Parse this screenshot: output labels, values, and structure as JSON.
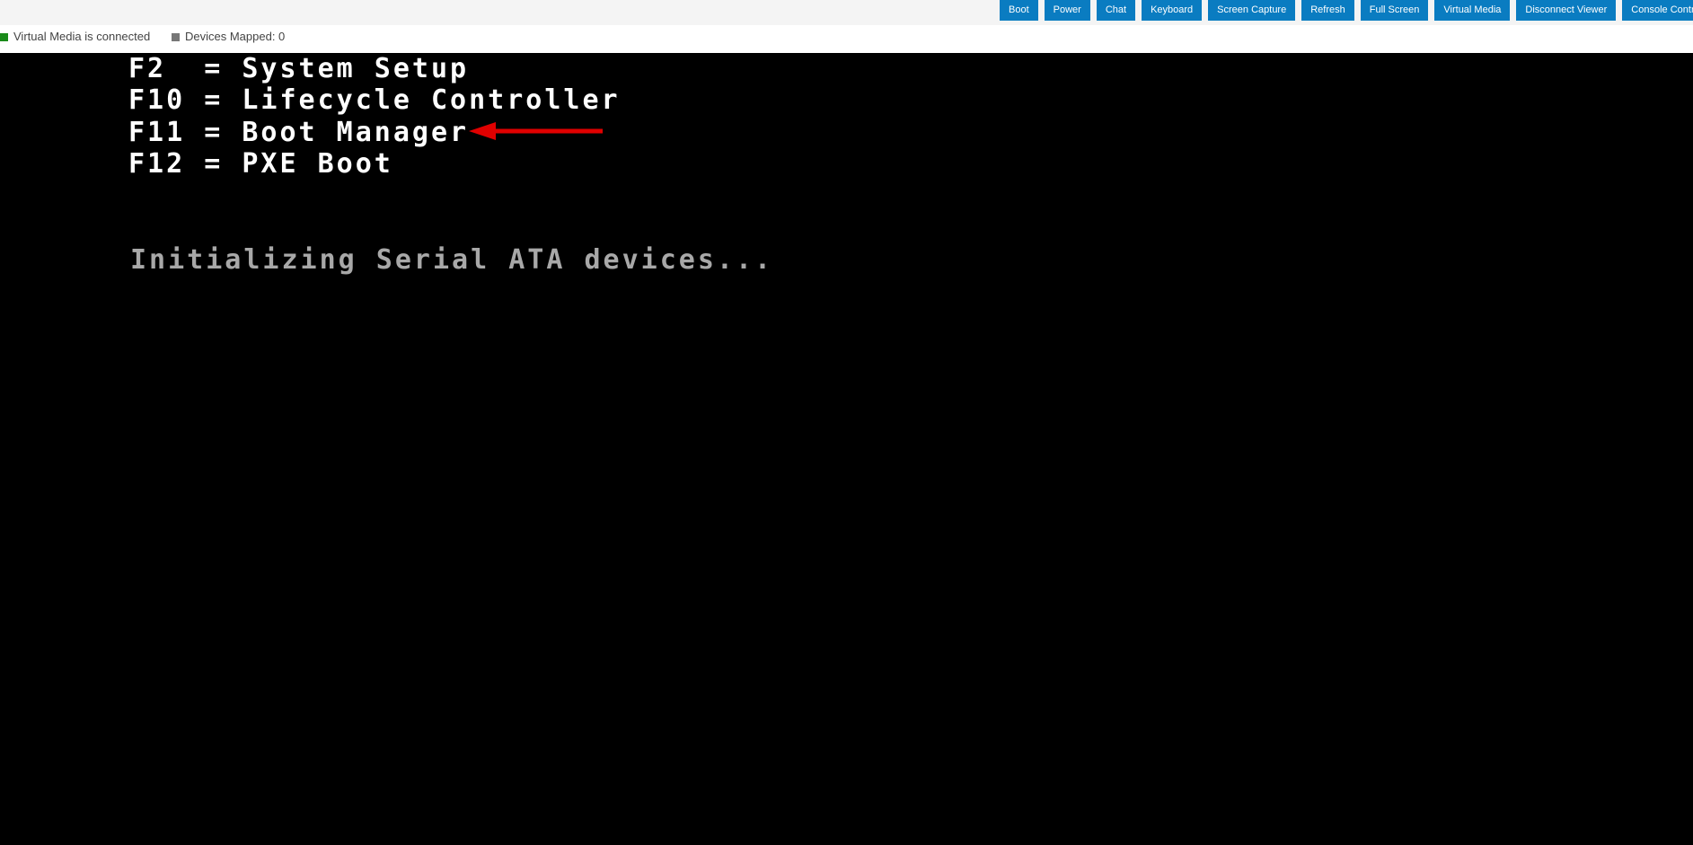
{
  "toolbar": {
    "buttons": [
      {
        "label": "Boot"
      },
      {
        "label": "Power"
      },
      {
        "label": "Chat"
      },
      {
        "label": "Keyboard"
      },
      {
        "label": "Screen Capture"
      },
      {
        "label": "Refresh"
      },
      {
        "label": "Full Screen"
      },
      {
        "label": "Virtual Media"
      },
      {
        "label": "Disconnect Viewer"
      },
      {
        "label": "Console Contro"
      }
    ],
    "accent_color": "#0a7cc1"
  },
  "status": {
    "virtual_media": "Virtual Media is connected",
    "virtual_media_color": "#1a8a1a",
    "devices_mapped": "Devices Mapped: 0",
    "devices_mapped_color": "#777777"
  },
  "console": {
    "lines": [
      "F2  = System Setup",
      "F10 = Lifecycle Controller",
      "F11 = Boot Manager",
      "F12 = PXE Boot"
    ],
    "status_message": "Initializing Serial ATA devices...",
    "annotation_arrow_color": "#e00000"
  }
}
